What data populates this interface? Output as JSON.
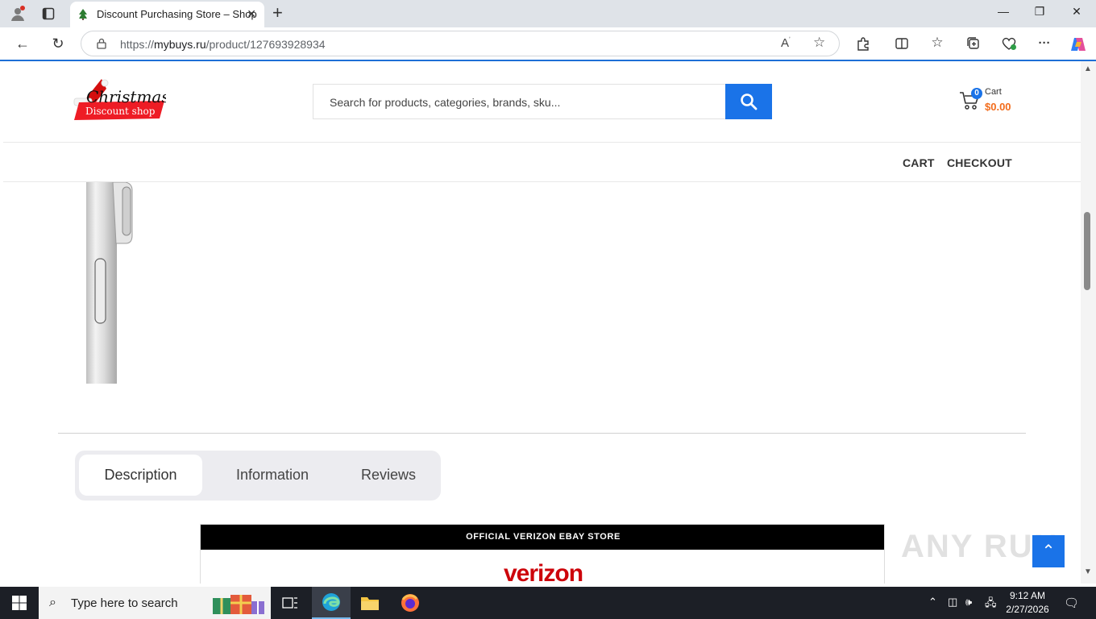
{
  "browser": {
    "tab_title": "Discount Purchasing Store – Shop",
    "url_prefix": "https://",
    "url_domain": "mybuys.ru",
    "url_path": "/product/127693928934"
  },
  "site": {
    "logo_text_top": "Christmas",
    "logo_text_bottom": "Discount shop",
    "search_placeholder": "Search for products, categories, brands, sku...",
    "cart_label": "Cart",
    "cart_count": "0",
    "cart_total": "$0.00",
    "nav": [
      "CART",
      "CHECKOUT"
    ],
    "tabs": [
      "Description",
      "Information",
      "Reviews"
    ],
    "active_tab": "Description",
    "banner_title": "OFFICIAL VERIZON EBAY STORE",
    "banner_logo": "verizon",
    "watermark": "ANY RUN",
    "scroll_top_icon": "chevron-up-icon"
  },
  "taskbar": {
    "search_placeholder": "Type here to search",
    "time": "9:12 AM",
    "date": "2/27/2026"
  },
  "colors": {
    "accent": "#1a73e8",
    "price": "#f26c1c",
    "verizon": "#cd040b"
  }
}
